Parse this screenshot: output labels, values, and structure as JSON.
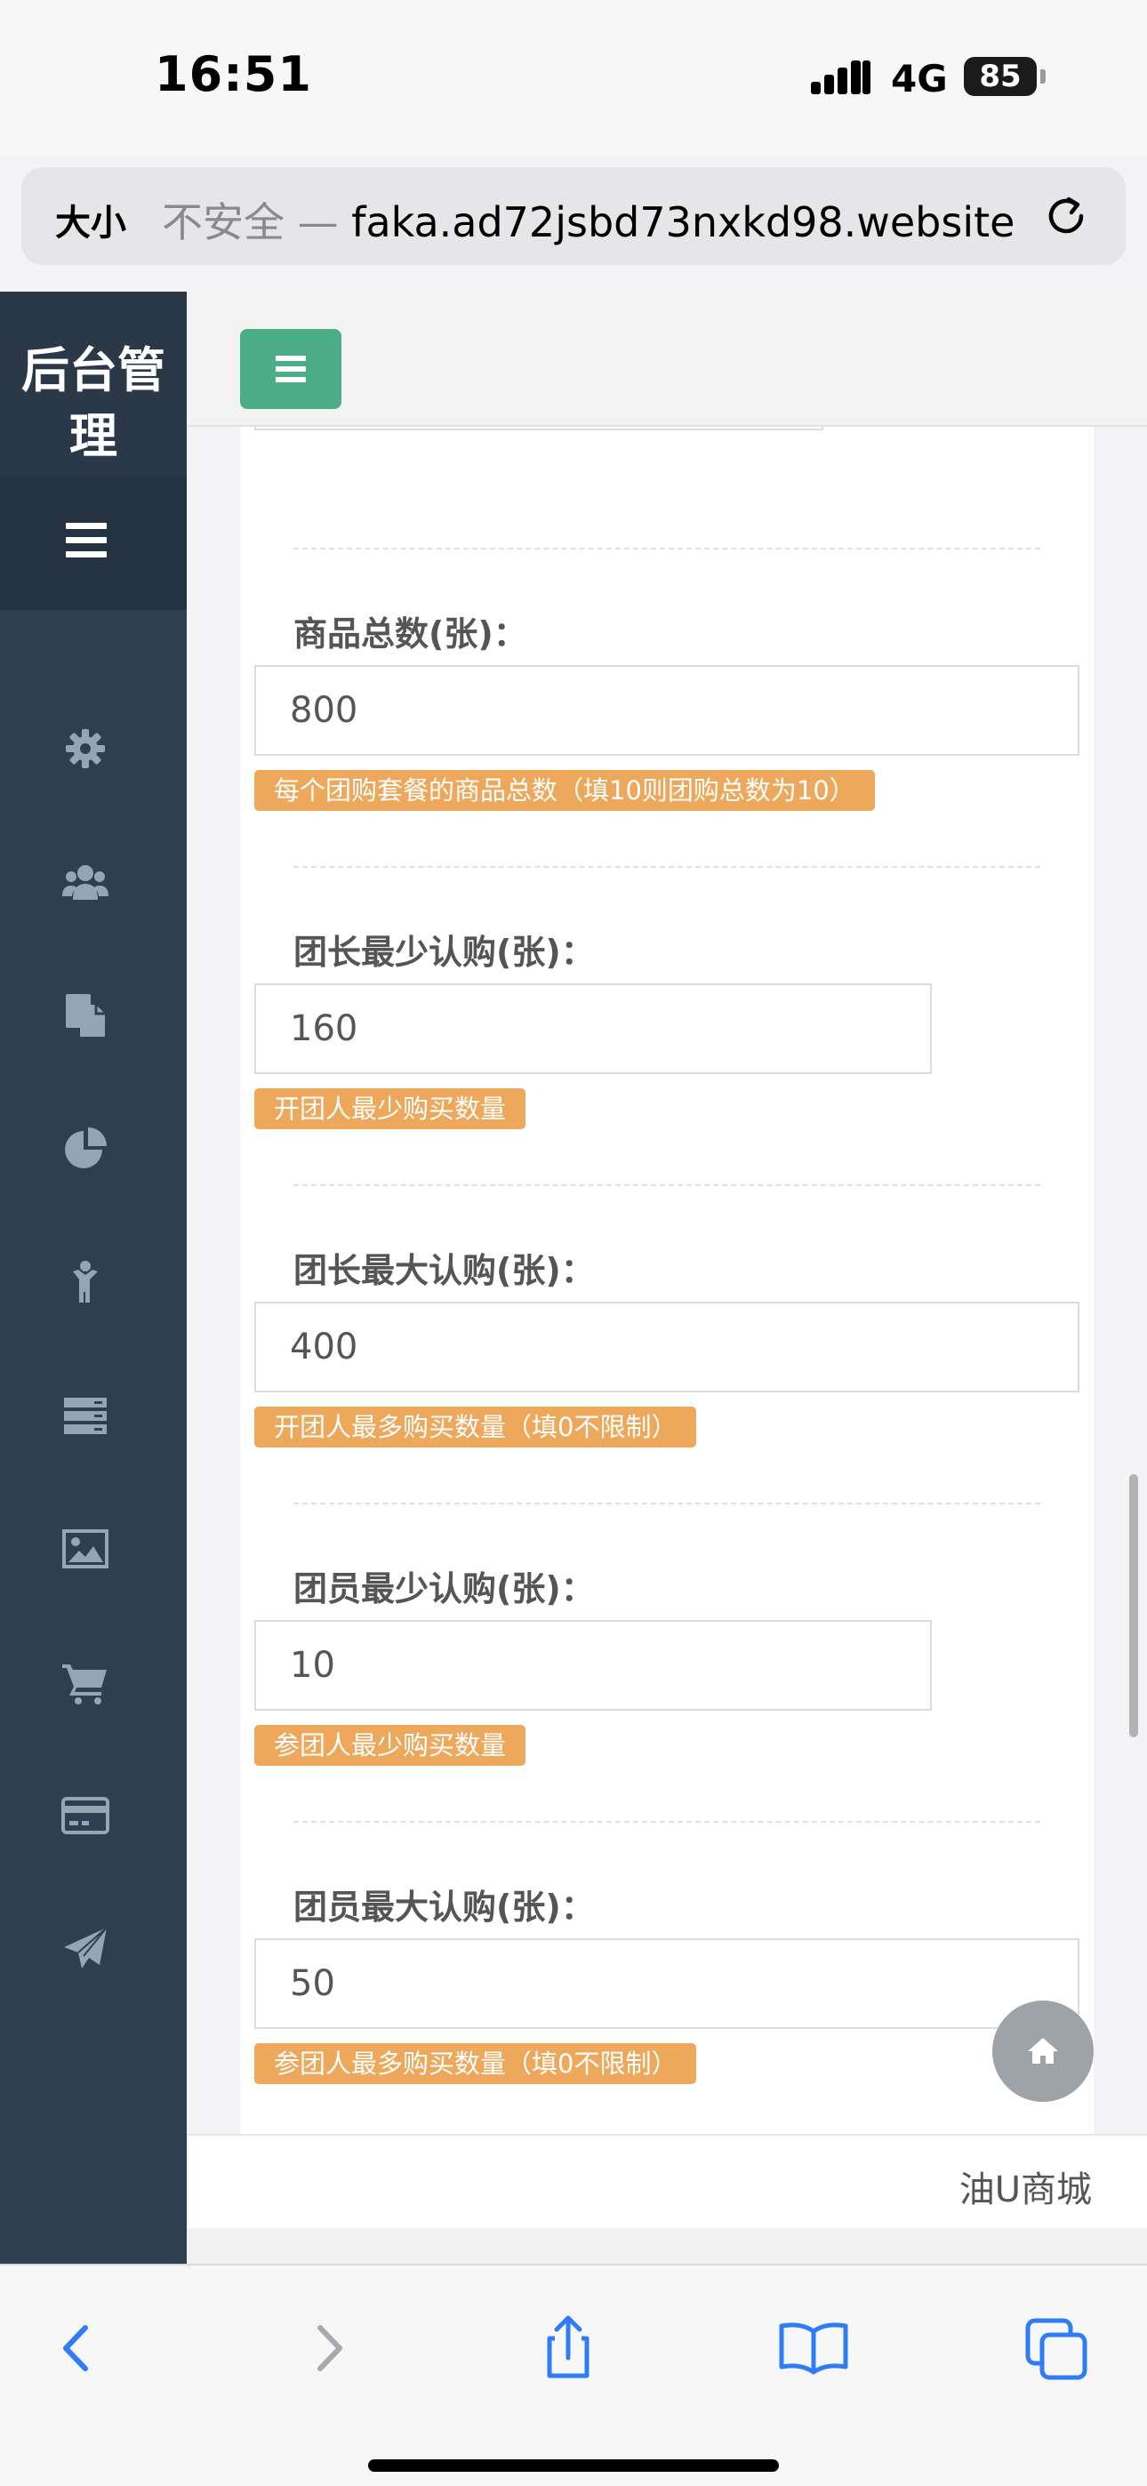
{
  "status_bar": {
    "time": "16:51",
    "network": "4G",
    "battery": "85"
  },
  "url_bar": {
    "text_size": "大小",
    "insecure_label": "不安全 — ",
    "domain": "faka.ad72jsbd73nxkd98.website"
  },
  "sidebar": {
    "brand": "后台管理",
    "icons": [
      "gear-icon",
      "users-icon",
      "copy-icon",
      "pie-chart-icon",
      "child-icon",
      "server-icon",
      "image-icon",
      "cart-icon",
      "credit-card-icon",
      "paper-plane-icon"
    ]
  },
  "form": {
    "fields": [
      {
        "label": "商品总数(张)：",
        "value": "800",
        "hint": "每个团购套餐的商品总数（填10则团购总数为10）"
      },
      {
        "label": "团长最少认购(张)：",
        "value": "160",
        "hint": "开团人最少购买数量"
      },
      {
        "label": "团长最大认购(张)：",
        "value": "400",
        "hint": "开团人最多购买数量（填0不限制）"
      },
      {
        "label": "团员最少认购(张)：",
        "value": "10",
        "hint": "参团人最少购买数量"
      },
      {
        "label": "团员最大认购(张)：",
        "value": "50",
        "hint": "参团人最多购买数量（填0不限制）"
      }
    ]
  },
  "footer": {
    "text": "油U商城"
  },
  "colors": {
    "sidebar": "#2f3e50",
    "menu_button": "#4cae89",
    "hint_badge": "#eda85c",
    "home_fab": "#9ea3a8"
  }
}
